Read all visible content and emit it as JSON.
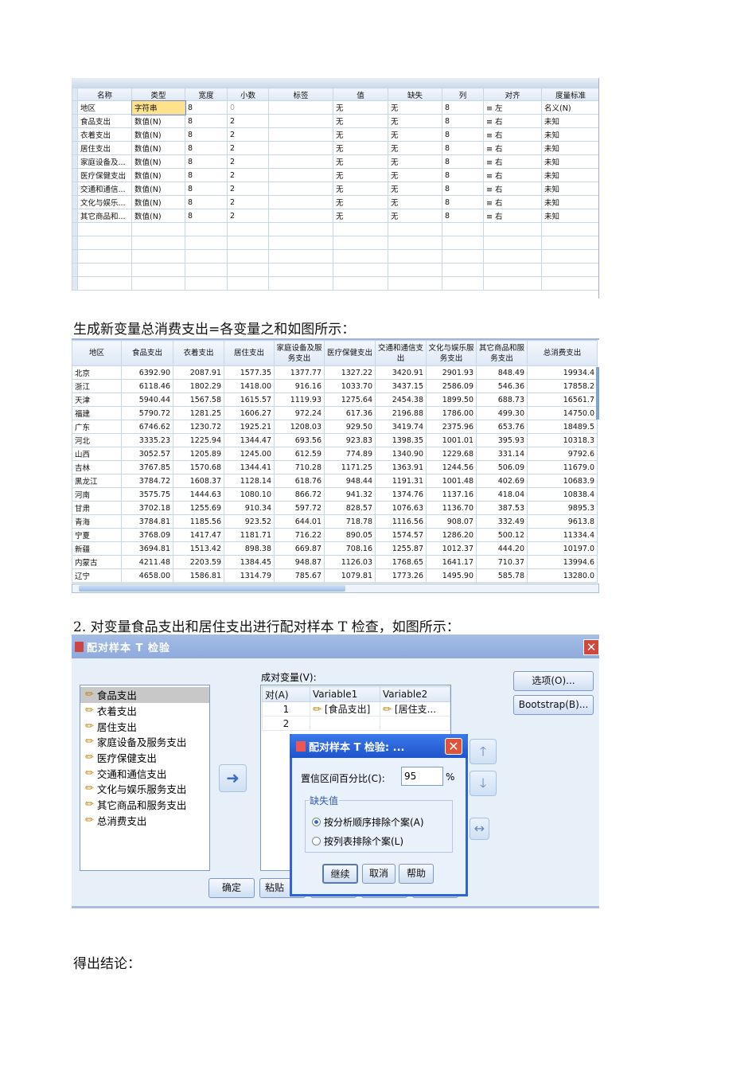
{
  "var_view": {
    "headers": [
      "名称",
      "类型",
      "宽度",
      "小数",
      "标签",
      "值",
      "缺失",
      "列",
      "对齐",
      "度量标准"
    ],
    "rows": [
      [
        "地区",
        "字符串",
        "8",
        "0",
        "",
        "无",
        "无",
        "8",
        "左",
        "名义(N)"
      ],
      [
        "食品支出",
        "数值(N)",
        "8",
        "2",
        "",
        "无",
        "无",
        "8",
        "右",
        "未知"
      ],
      [
        "衣着支出",
        "数值(N)",
        "8",
        "2",
        "",
        "无",
        "无",
        "8",
        "右",
        "未知"
      ],
      [
        "居住支出",
        "数值(N)",
        "8",
        "2",
        "",
        "无",
        "无",
        "8",
        "右",
        "未知"
      ],
      [
        "家庭设备及...",
        "数值(N)",
        "8",
        "2",
        "",
        "无",
        "无",
        "8",
        "右",
        "未知"
      ],
      [
        "医疗保健支出",
        "数值(N)",
        "8",
        "2",
        "",
        "无",
        "无",
        "8",
        "右",
        "未知"
      ],
      [
        "交通和通信...",
        "数值(N)",
        "8",
        "2",
        "",
        "无",
        "无",
        "8",
        "右",
        "未知"
      ],
      [
        "文化与娱乐...",
        "数值(N)",
        "8",
        "2",
        "",
        "无",
        "无",
        "8",
        "右",
        "未知"
      ],
      [
        "其它商品和...",
        "数值(N)",
        "8",
        "2",
        "",
        "无",
        "无",
        "8",
        "右",
        "未知"
      ]
    ]
  },
  "caption1": "生成新变量总消费支出=各变量之和如图所示：",
  "data_view": {
    "headers": [
      "地区",
      "食品支出",
      "衣着支出",
      "居住支出",
      "家庭设备及服务支出",
      "医疗保健支出",
      "交通和通信支出",
      "文化与娱乐服务支出",
      "其它商品和服务支出",
      "总消费支出"
    ],
    "rows": [
      [
        "北京",
        "6392.90",
        "2087.91",
        "1577.35",
        "1377.77",
        "1327.22",
        "3420.91",
        "2901.93",
        "848.49",
        "19934.4"
      ],
      [
        "浙江",
        "6118.46",
        "1802.29",
        "1418.00",
        "916.16",
        "1033.70",
        "3437.15",
        "2586.09",
        "546.36",
        "17858.2"
      ],
      [
        "天津",
        "5940.44",
        "1567.58",
        "1615.57",
        "1119.93",
        "1275.64",
        "2454.38",
        "1899.50",
        "688.73",
        "16561.7"
      ],
      [
        "福建",
        "5790.72",
        "1281.25",
        "1606.27",
        "972.24",
        "617.36",
        "2196.88",
        "1786.00",
        "499.30",
        "14750.0"
      ],
      [
        "广东",
        "6746.62",
        "1230.72",
        "1925.21",
        "1208.03",
        "929.50",
        "3419.74",
        "2375.96",
        "653.76",
        "18489.5"
      ],
      [
        "河北",
        "3335.23",
        "1225.94",
        "1344.47",
        "693.56",
        "923.83",
        "1398.35",
        "1001.01",
        "395.93",
        "10318.3"
      ],
      [
        "山西",
        "3052.57",
        "1205.89",
        "1245.00",
        "612.59",
        "774.89",
        "1340.90",
        "1229.68",
        "331.14",
        "9792.6"
      ],
      [
        "吉林",
        "3767.85",
        "1570.68",
        "1344.41",
        "710.28",
        "1171.25",
        "1363.91",
        "1244.56",
        "506.09",
        "11679.0"
      ],
      [
        "黑龙江",
        "3784.72",
        "1608.37",
        "1128.14",
        "618.76",
        "948.44",
        "1191.31",
        "1001.48",
        "402.69",
        "10683.9"
      ],
      [
        "河南",
        "3575.75",
        "1444.63",
        "1080.10",
        "866.72",
        "941.32",
        "1374.76",
        "1137.16",
        "418.04",
        "10838.4"
      ],
      [
        "甘肃",
        "3702.18",
        "1255.69",
        "910.34",
        "597.72",
        "828.57",
        "1076.63",
        "1136.70",
        "387.53",
        "9895.3"
      ],
      [
        "青海",
        "3784.81",
        "1185.56",
        "923.52",
        "644.01",
        "718.78",
        "1116.56",
        "908.07",
        "332.49",
        "9613.8"
      ],
      [
        "宁夏",
        "3768.09",
        "1417.47",
        "1181.71",
        "716.22",
        "890.05",
        "1574.57",
        "1286.20",
        "500.12",
        "11334.4"
      ],
      [
        "新疆",
        "3694.81",
        "1513.42",
        "898.38",
        "669.87",
        "708.16",
        "1255.87",
        "1012.37",
        "444.20",
        "10197.0"
      ],
      [
        "内蒙古",
        "4211.48",
        "2203.59",
        "1384.45",
        "948.87",
        "1126.03",
        "1768.65",
        "1641.17",
        "710.37",
        "13994.6"
      ],
      [
        "辽宁",
        "4658.00",
        "1586.81",
        "1314.79",
        "785.67",
        "1079.81",
        "1773.26",
        "1495.90",
        "585.78",
        "13280.0"
      ]
    ]
  },
  "caption2": "2.  对变量食品支出和居住支出进行配对样本 T 检查，如图所示：",
  "dialog": {
    "title": "配对样本 T 检验",
    "variables": [
      "食品支出",
      "衣着支出",
      "居住支出",
      "家庭设备及服务支出",
      "医疗保健支出",
      "交通和通信支出",
      "文化与娱乐服务支出",
      "其它商品和服务支出",
      "总消费支出"
    ],
    "pairs_label": "成对变量(V):",
    "pair_headers": [
      "对(A)",
      "Variable1",
      "Variable2"
    ],
    "pairs": [
      [
        "1",
        "[食品支出]",
        "[居住支..."
      ],
      [
        "2",
        "",
        ""
      ]
    ],
    "options_btn": "选项(O)...",
    "bootstrap_btn": "Bootstrap(B)...",
    "ok_btn": "确定",
    "paste_btn": "粘贴"
  },
  "subdialog": {
    "title": "配对样本 T 检验: ...",
    "ci_label": "置信区间百分比(C):",
    "ci_value": "95",
    "pct": "%",
    "missing_legend": "缺失值",
    "radio1": "按分析顺序排除个案(A)",
    "radio2": "按列表排除个案(L)",
    "continue_btn": "继续",
    "cancel_btn": "取消",
    "help_btn": "帮助"
  },
  "caption3": "得出结论："
}
